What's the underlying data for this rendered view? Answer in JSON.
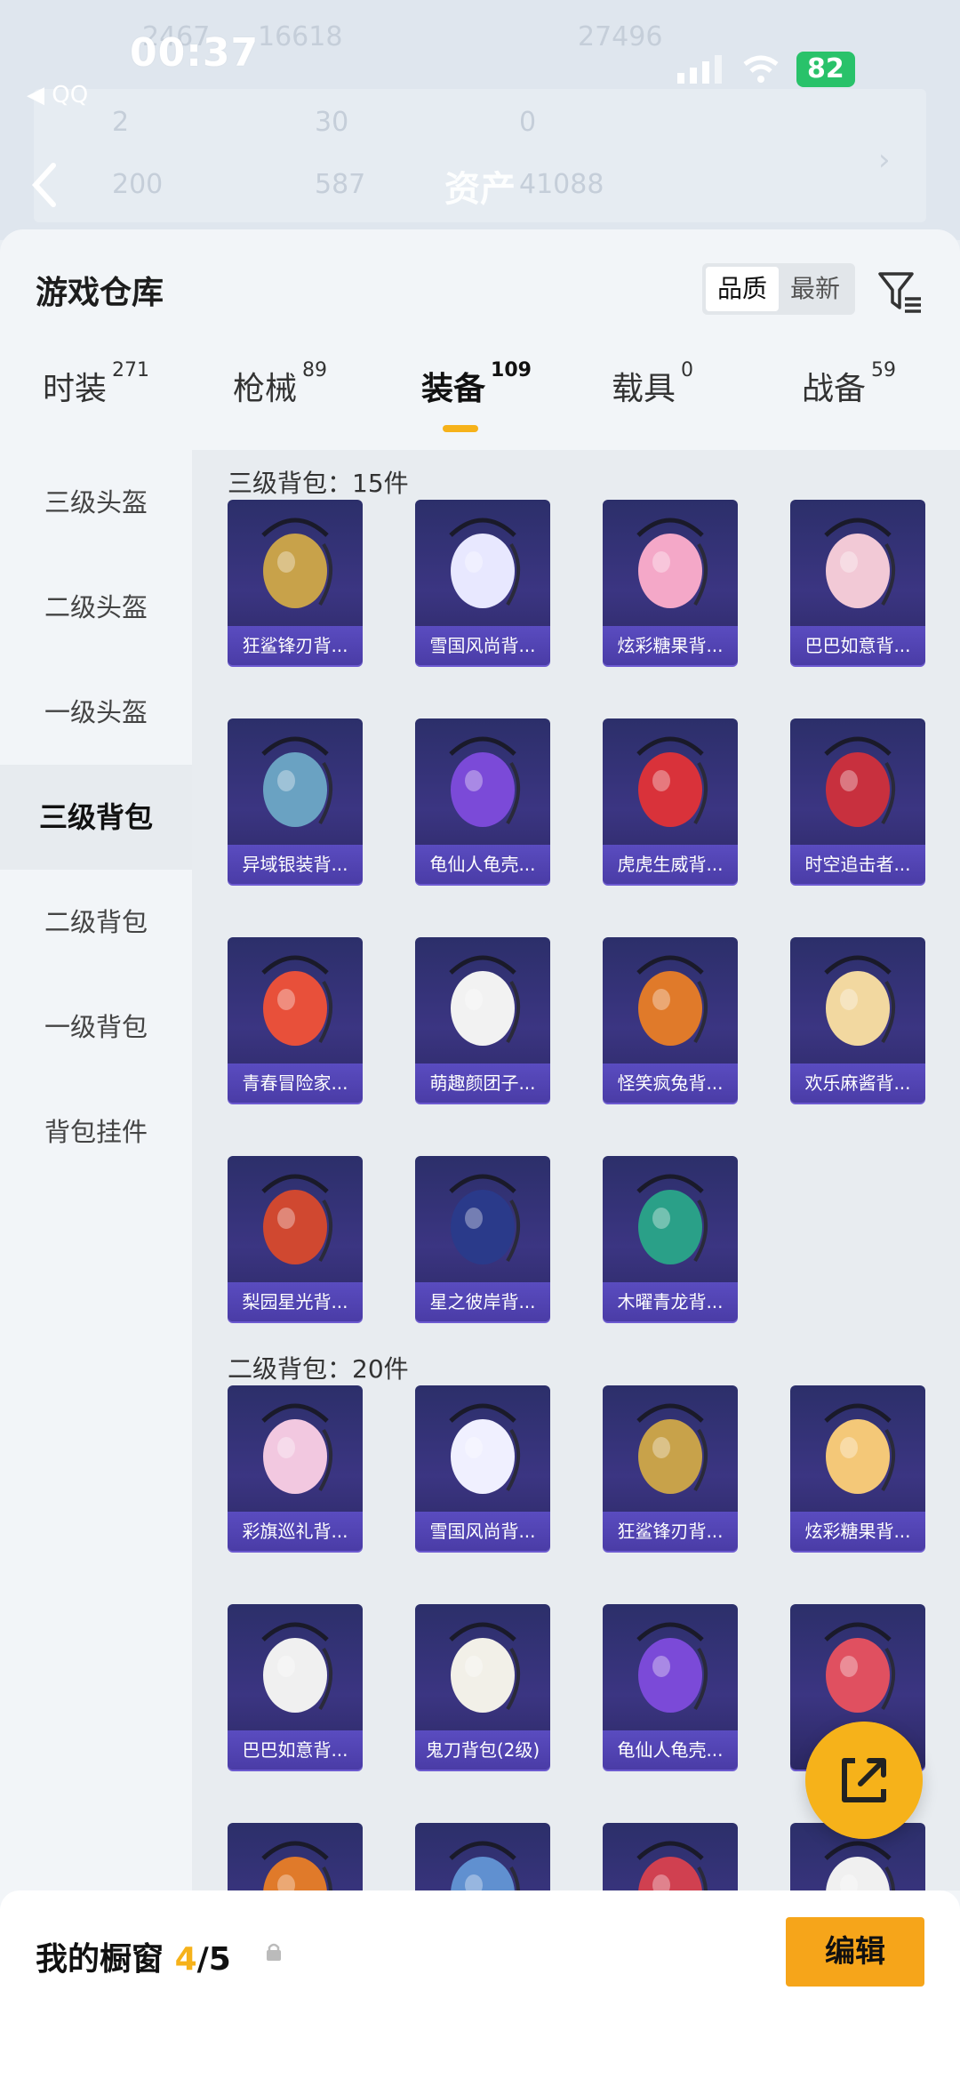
{
  "status": {
    "time": "00:37",
    "back_app": "◀ QQ",
    "battery": "82"
  },
  "ghost": {
    "top_nums": [
      "2467",
      "16618",
      "27496"
    ],
    "row1": [
      "2",
      "30",
      "0"
    ],
    "row2": [
      "200",
      "587",
      "41088"
    ],
    "title": "资产"
  },
  "header": {
    "title": "游戏仓库",
    "toggle": [
      "品质",
      "最新"
    ],
    "active_toggle": "品质"
  },
  "tabs": [
    {
      "label": "时装",
      "count": "271"
    },
    {
      "label": "枪械",
      "count": "89"
    },
    {
      "label": "装备",
      "count": "109"
    },
    {
      "label": "载具",
      "count": "0"
    },
    {
      "label": "战备",
      "count": "59"
    }
  ],
  "sidebar": [
    "三级头盔",
    "二级头盔",
    "一级头盔",
    "三级背包",
    "二级背包",
    "一级背包",
    "背包挂件"
  ],
  "sections": [
    {
      "title": "三级背包：15件",
      "items": [
        "狂鲨锋刃背...",
        "雪国风尚背...",
        "炫彩糖果背...",
        "巴巴如意背...",
        "异域银装背...",
        "龟仙人龟壳...",
        "虎虎生威背...",
        "时空追击者...",
        "青春冒险家...",
        "萌趣颜团子...",
        "怪笑疯兔背...",
        "欢乐麻酱背...",
        "梨园星光背...",
        "星之彼岸背...",
        "木曜青龙背..."
      ]
    },
    {
      "title": "二级背包：20件",
      "items": [
        "彩旗巡礼背...",
        "雪国风尚背...",
        "狂鲨锋刃背...",
        "炫彩糖果背...",
        "巴巴如意背...",
        "鬼刀背包(2级)",
        "龟仙人龟壳...",
        "",
        "",
        "",
        "",
        ""
      ]
    }
  ],
  "bottom": {
    "label": "我的橱窗",
    "current": "4",
    "total": "/5",
    "edit": "编辑"
  },
  "colors": {
    "accent": "#f6b21a",
    "card": "#3b3582",
    "card_label": "#5a4cc0"
  }
}
